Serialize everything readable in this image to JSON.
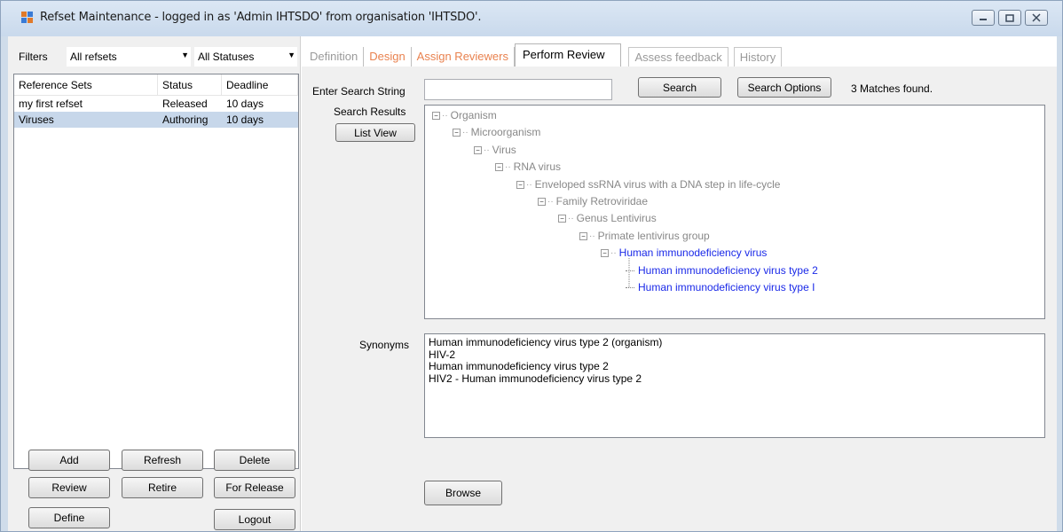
{
  "window": {
    "title": "Refset Maintenance - logged in as 'Admin IHTSDO' from organisation 'IHTSDO'.",
    "controls": [
      "minimize-icon",
      "maximize-icon",
      "close-icon"
    ]
  },
  "filters": {
    "label": "Filters",
    "refset_filter": "All refsets",
    "status_filter": "All Statuses"
  },
  "refsets": {
    "columns": [
      "Reference Sets",
      "Status",
      "Deadline"
    ],
    "rows": [
      {
        "name": "my first refset",
        "status": "Released",
        "deadline": "10 days",
        "selected": false
      },
      {
        "name": "Viruses",
        "status": "Authoring",
        "deadline": "10 days",
        "selected": true
      }
    ]
  },
  "left_buttons": {
    "add": "Add",
    "refresh": "Refresh",
    "delete": "Delete",
    "review": "Review",
    "retire": "Retire",
    "for_release": "For Release",
    "define": "Define",
    "logout": "Logout"
  },
  "tabs": [
    {
      "label": "Definition",
      "state": "disabled"
    },
    {
      "label": "Design",
      "state": "orange"
    },
    {
      "label": "Assign Reviewers",
      "state": "orange"
    },
    {
      "label": "Perform Review",
      "state": "active"
    },
    {
      "label": "Assess feedback",
      "state": "disabled"
    },
    {
      "label": "History",
      "state": "disabled"
    }
  ],
  "search": {
    "label": "Enter Search String",
    "value": "",
    "search_button": "Search",
    "options_button": "Search Options",
    "matches": "3 Matches found.",
    "results_label": "Search Results",
    "list_view_button": "List View"
  },
  "tree": [
    {
      "label": "Organism",
      "depth": 0,
      "color": "grey",
      "toggle": "minus"
    },
    {
      "label": "Microorganism",
      "depth": 1,
      "color": "grey",
      "toggle": "minus"
    },
    {
      "label": "Virus",
      "depth": 2,
      "color": "grey",
      "toggle": "minus"
    },
    {
      "label": "RNA virus",
      "depth": 3,
      "color": "grey",
      "toggle": "minus"
    },
    {
      "label": "Enveloped ssRNA virus with a DNA step in life-cycle",
      "depth": 4,
      "color": "grey",
      "toggle": "minus"
    },
    {
      "label": "Family Retroviridae",
      "depth": 5,
      "color": "grey",
      "toggle": "minus"
    },
    {
      "label": "Genus Lentivirus",
      "depth": 6,
      "color": "grey",
      "toggle": "minus"
    },
    {
      "label": "Primate lentivirus group",
      "depth": 7,
      "color": "grey",
      "toggle": "minus"
    },
    {
      "label": "Human immunodeficiency virus",
      "depth": 8,
      "color": "blue",
      "toggle": "minus"
    },
    {
      "label": "Human immunodeficiency virus type 2",
      "depth": 9,
      "color": "blue",
      "toggle": "leaf"
    },
    {
      "label": "Human immunodeficiency virus type I",
      "depth": 9,
      "color": "blue",
      "toggle": "leaf"
    }
  ],
  "synonyms": {
    "label": "Synonyms",
    "items": [
      "Human immunodeficiency virus type 2 (organism)",
      "HIV-2",
      "Human immunodeficiency virus type 2",
      "HIV2 - Human immunodeficiency virus type 2"
    ]
  },
  "browse_button": "Browse"
}
